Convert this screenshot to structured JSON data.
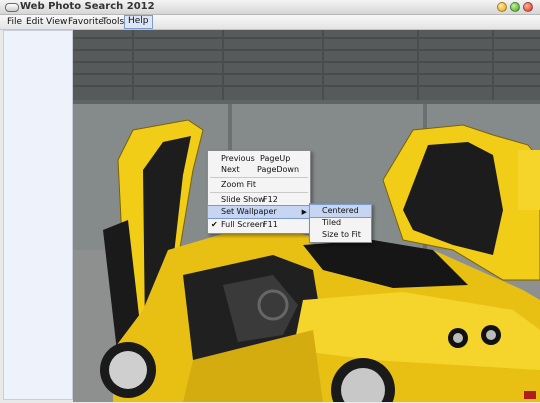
{
  "window": {
    "title": "Web Photo Search 2012"
  },
  "menubar": {
    "items": [
      {
        "label": "File"
      },
      {
        "label": "Edit"
      },
      {
        "label": "View"
      },
      {
        "label": "Favorite"
      },
      {
        "label": "Tools"
      },
      {
        "label": "Help"
      }
    ],
    "active": "Help"
  },
  "photo": {
    "subject": "yellow sports car with open doors"
  },
  "context_menu": {
    "items": [
      {
        "label": "Previous",
        "shortcut": "PageUp"
      },
      {
        "label": "Next",
        "shortcut": "PageDown"
      },
      {
        "label": "Zoom Fit",
        "shortcut": ""
      },
      {
        "label": "Slide Show",
        "shortcut": "F12"
      },
      {
        "label": "Set Wallpaper",
        "shortcut": "",
        "submenu": true,
        "highlighted": true
      },
      {
        "label": "Full Screen",
        "shortcut": "F11",
        "checked": true
      }
    ],
    "submenu": {
      "items": [
        {
          "label": "Centered",
          "highlighted": true
        },
        {
          "label": "Tiled"
        },
        {
          "label": "Size to Fit"
        }
      ]
    }
  },
  "colors": {
    "accent": "#7a98d4",
    "highlight": "#c5d5f2",
    "car": "#f2cd18"
  }
}
